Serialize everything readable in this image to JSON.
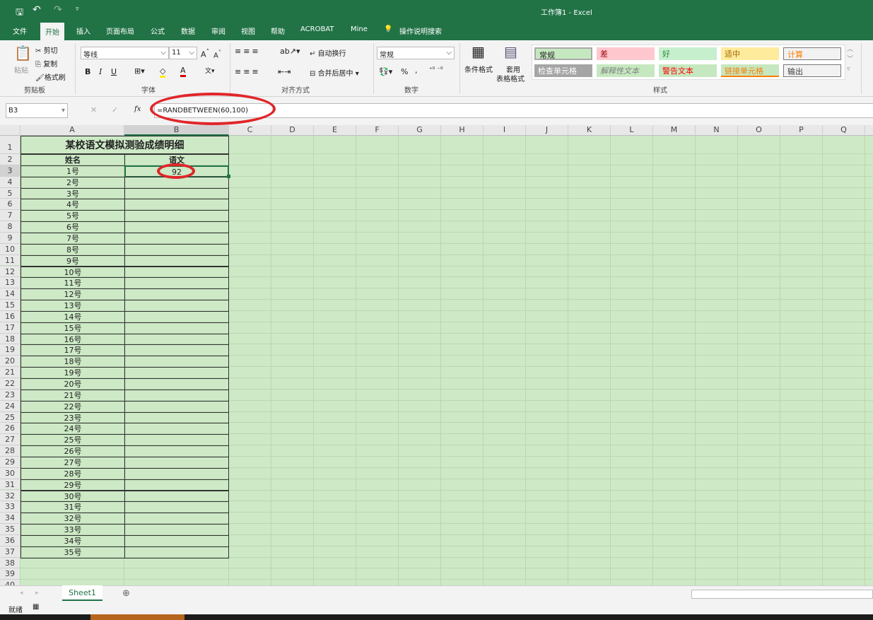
{
  "window": {
    "title": "工作簿1 - Excel"
  },
  "qat": {
    "save_icon": "save-icon",
    "undo_icon": "undo-icon",
    "redo_icon": "redo-icon"
  },
  "tabs": [
    "文件",
    "开始",
    "插入",
    "页面布局",
    "公式",
    "数据",
    "审阅",
    "视图",
    "帮助",
    "ACROBAT",
    "Mine"
  ],
  "tell_me": "操作说明搜索",
  "ribbon": {
    "clipboard": {
      "paste": "粘贴",
      "cut": "剪切",
      "copy": "复制",
      "format_painter": "格式刷",
      "label": "剪贴板"
    },
    "font": {
      "name": "等线",
      "size": "11",
      "label": "字体",
      "bold": "B",
      "italic": "I",
      "underline": "U"
    },
    "alignment": {
      "wrap": "自动换行",
      "merge": "合并后居中",
      "label": "对齐方式"
    },
    "number": {
      "format": "常规",
      "percent": "%",
      "comma": ",",
      "label": "数字"
    },
    "styles": {
      "conditional": "条件格式",
      "table_l1": "套用",
      "table_l2": "表格格式",
      "label": "样式",
      "items": [
        {
          "text": "常规",
          "bg": "#c6e8c0",
          "fg": "#222"
        },
        {
          "text": "差",
          "bg": "#ffc7ce",
          "fg": "#9c0006"
        },
        {
          "text": "好",
          "bg": "#c6efce",
          "fg": "#2e8b3a"
        },
        {
          "text": "适中",
          "bg": "#ffeb9c",
          "fg": "#9c6500"
        },
        {
          "text": "计算",
          "bg": "#f2f2f2",
          "fg": "#fa7d00"
        },
        {
          "text": "检查单元格",
          "bg": "#a5a5a5",
          "fg": "#fff"
        },
        {
          "text": "解释性文本",
          "bg": "#c6e8c0",
          "fg": "#7f7f7f"
        },
        {
          "text": "警告文本",
          "bg": "#c6e8c0",
          "fg": "#ff0000"
        },
        {
          "text": "链接单元格",
          "bg": "#c6e8c0",
          "fg": "#fa7d00"
        },
        {
          "text": "输出",
          "bg": "#f2f2f2",
          "fg": "#3f3f3f"
        }
      ]
    }
  },
  "formula_bar": {
    "name_box": "B3",
    "fx": "fx",
    "formula": "=RANDBETWEEN(60,100)"
  },
  "columns": [
    "A",
    "B",
    "C",
    "D",
    "E",
    "F",
    "G",
    "H",
    "I",
    "J",
    "K",
    "L",
    "M",
    "N",
    "O",
    "P",
    "Q"
  ],
  "sheet": {
    "title": "某校语文模拟测验成绩明细",
    "header_name": "姓名",
    "header_score": "语文",
    "b3_value": "92",
    "names": [
      "1号",
      "2号",
      "3号",
      "4号",
      "5号",
      "6号",
      "7号",
      "8号",
      "9号",
      "10号",
      "11号",
      "12号",
      "13号",
      "14号",
      "15号",
      "16号",
      "17号",
      "18号",
      "19号",
      "20号",
      "21号",
      "22号",
      "23号",
      "24号",
      "25号",
      "26号",
      "27号",
      "28号",
      "29号",
      "30号",
      "31号",
      "32号",
      "33号",
      "34号",
      "35号"
    ]
  },
  "sheet_tabs": [
    "Sheet1"
  ],
  "status": {
    "text": "就绪"
  },
  "accent": "#217346",
  "annotation_color": "#e0262a"
}
